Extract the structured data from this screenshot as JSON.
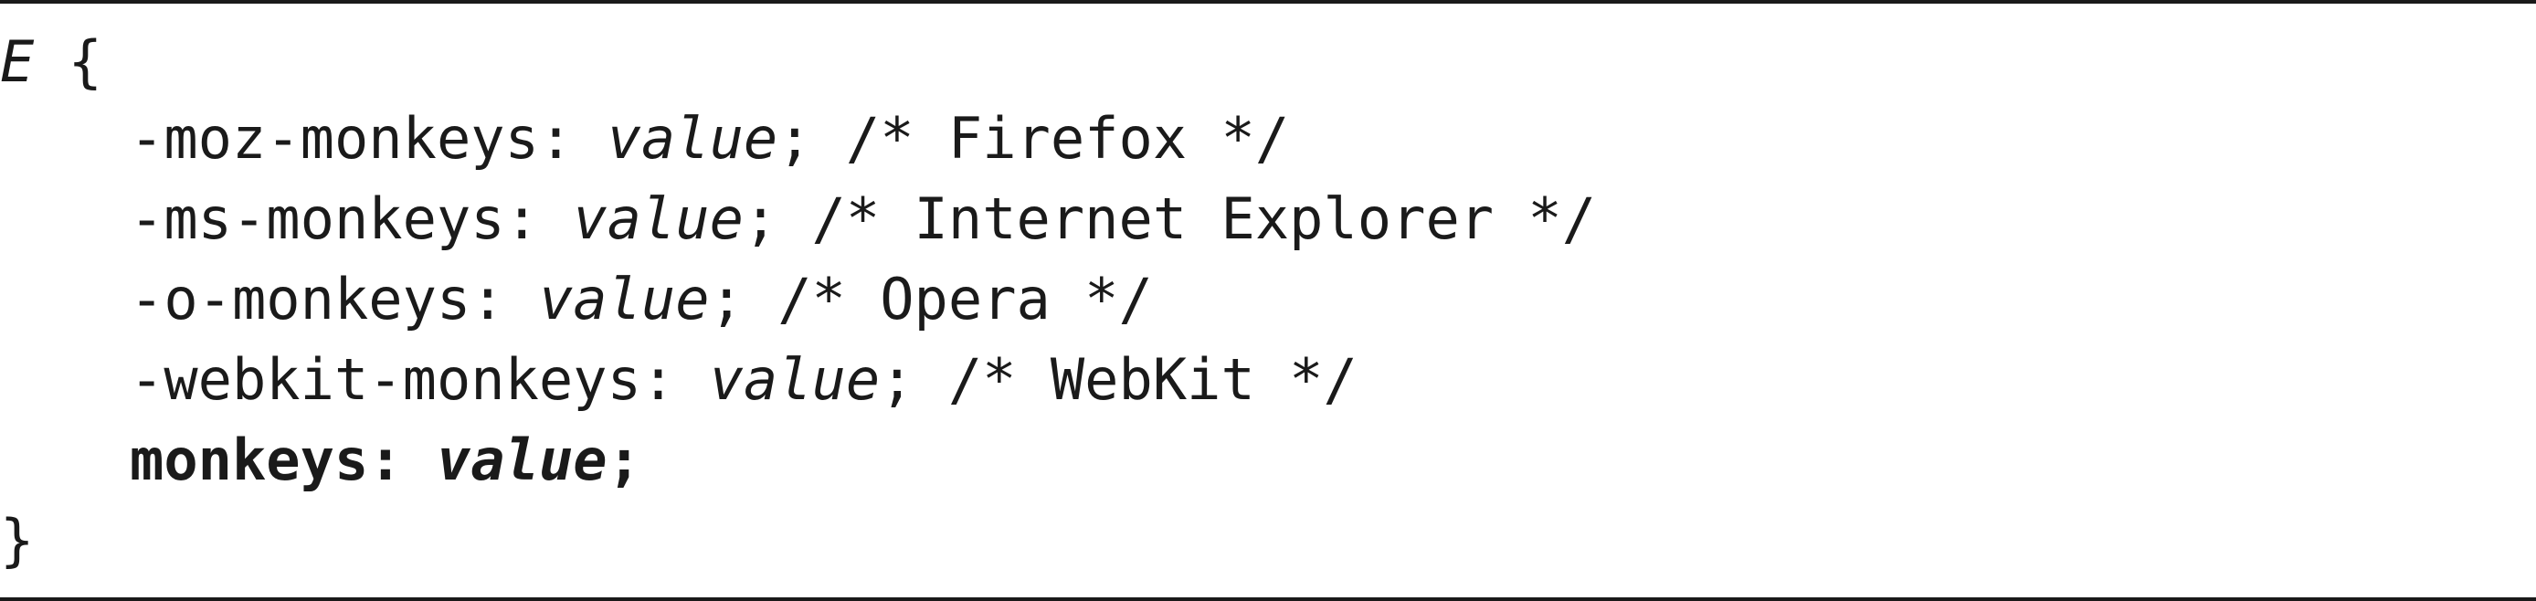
{
  "code": {
    "open": {
      "selector": "E",
      "brace": " {"
    },
    "lines": [
      {
        "prop": "-moz-monkeys: ",
        "value": "value",
        "rest": "; /* Firefox */"
      },
      {
        "prop": "-ms-monkeys: ",
        "value": "value",
        "rest": "; /* Internet Explorer */"
      },
      {
        "prop": "-o-monkeys: ",
        "value": "value",
        "rest": "; /* Opera */"
      },
      {
        "prop": "-webkit-monkeys: ",
        "value": "value",
        "rest": "; /* WebKit */"
      }
    ],
    "standard": {
      "prop": "monkeys: ",
      "value": "value",
      "rest": ";"
    },
    "close": "}"
  }
}
